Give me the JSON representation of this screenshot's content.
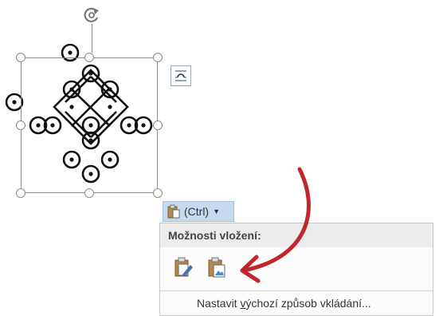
{
  "canvas": {
    "shape_description": "kolam-pattern"
  },
  "paste_chip": {
    "label": "(Ctrl)",
    "icon": "paste-clipboard-icon"
  },
  "paste_menu": {
    "header": "Možnosti vložení:",
    "options": [
      {
        "icon": "keep-source-formatting-icon"
      },
      {
        "icon": "picture-paste-icon"
      }
    ],
    "set_default_prefix": "Nastavit ",
    "set_default_accel": "v",
    "set_default_suffix": "ýchozí způsob vkládání..."
  },
  "layout_options": {
    "icon": "layout-options-icon"
  },
  "annotation": {
    "arrow_color": "#c0272d"
  },
  "colors": {
    "chip_bg": "#c7d9ee",
    "menu_header_bg": "#ececec",
    "handle_border": "#8a8a8a"
  }
}
